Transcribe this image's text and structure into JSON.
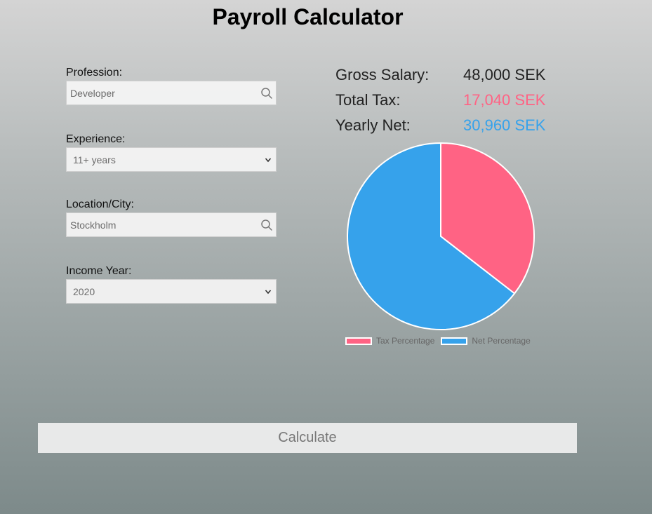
{
  "title": "Payroll Calculator",
  "form": {
    "profession": {
      "label": "Profession:",
      "value": "Developer",
      "icon": "search-icon"
    },
    "experience": {
      "label": "Experience:",
      "value": "11+ years",
      "icon": "chevron-down-icon"
    },
    "location": {
      "label": "Location/City:",
      "value": "Stockholm",
      "icon": "search-icon"
    },
    "income_year": {
      "label": "Income Year:",
      "value": "2020",
      "icon": "chevron-down-icon"
    }
  },
  "summary": {
    "gross_label": "Gross Salary:",
    "gross_value": "48,000 SEK",
    "tax_label": "Total Tax:",
    "tax_value": "17,040 SEK",
    "net_label": "Yearly Net:",
    "net_value": "30,960 SEK"
  },
  "colors": {
    "tax": "#ff6384",
    "net": "#36a2eb"
  },
  "chart_data": {
    "type": "pie",
    "categories": [
      "Tax Percentage",
      "Net Percentage"
    ],
    "values": [
      35.5,
      64.5
    ],
    "colors": [
      "#ff6384",
      "#36a2eb"
    ],
    "legend": "bottom"
  },
  "calculate_label": "Calculate"
}
